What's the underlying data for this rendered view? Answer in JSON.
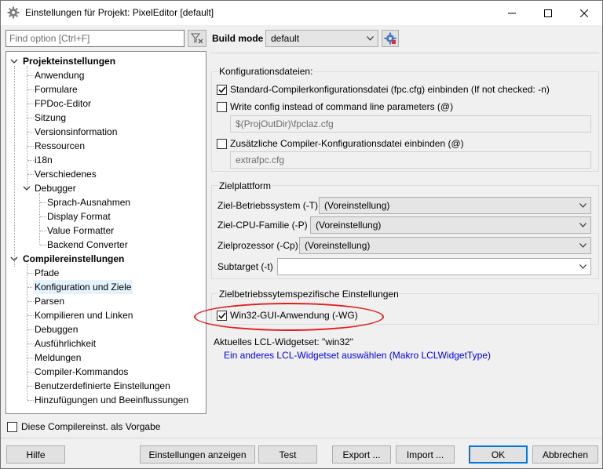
{
  "window": {
    "title": "Einstellungen für Projekt: PixelEditor [default]",
    "icon": "gear-icon"
  },
  "search": {
    "placeholder": "Find option [Ctrl+F]"
  },
  "tree": {
    "group1": "Projekteinstellungen",
    "items1": [
      "Anwendung",
      "Formulare",
      "FPDoc-Editor",
      "Sitzung",
      "Versionsinformation",
      "Ressourcen",
      "i18n",
      "Verschiedenes",
      "Debugger"
    ],
    "debugger_children": [
      "Sprach-Ausnahmen",
      "Display Format",
      "Value Formatter",
      "Backend Converter"
    ],
    "group2": "Compilereinstellungen",
    "items2": [
      "Pfade",
      "Konfiguration und Ziele",
      "Parsen",
      "Kompilieren und Linken",
      "Debuggen",
      "Ausführlichkeit",
      "Meldungen",
      "Compiler-Kommandos",
      "Benutzerdefinierte Einstellungen",
      "Hinzufügungen und Beeinflussungen"
    ],
    "selected": "Konfiguration und Ziele"
  },
  "bottom_check": {
    "label": "Diese Compilereinst. als Vorgabe",
    "checked": false
  },
  "build_mode": {
    "label": "Build mode",
    "value": "default"
  },
  "config_files": {
    "title": "Konfigurationsdateien:",
    "std_cfg": {
      "label": "Standard-Compilerkonfigurationsdatei (fpc.cfg) einbinden (If not checked: -n)",
      "checked": true
    },
    "write_cfg": {
      "label": "Write config instead of command line parameters (@)",
      "checked": false
    },
    "write_cfg_path": "$(ProjOutDir)\\fpclaz.cfg",
    "extra_cfg": {
      "label": "Zusätzliche Compiler-Konfigurationsdatei einbinden (@)",
      "checked": false
    },
    "extra_cfg_path": "extrafpc.cfg"
  },
  "target": {
    "title": "Zielplattform",
    "os_label": "Ziel-Betriebssystem (-T)",
    "os_value": "(Voreinstellung)",
    "cpu_family_label": "Ziel-CPU-Familie (-P)",
    "cpu_family_value": "(Voreinstellung)",
    "cpu_label": "Zielprozessor (-Cp)",
    "cpu_value": "(Voreinstellung)",
    "subtarget_label": "Subtarget (-t)",
    "subtarget_value": ""
  },
  "os_specific": {
    "title": "Zielbetriebssytemspezifische Einstellungen",
    "win32gui": {
      "label": "Win32-GUI-Anwendung (-WG)",
      "checked": true
    }
  },
  "lcl": {
    "current": "Aktuelles LCL-Widgetset: \"win32\"",
    "link": "Ein anderes LCL-Widgetset auswählen (Makro LCLWidgetType)"
  },
  "buttons": {
    "help": "Hilfe",
    "show_options": "Einstellungen anzeigen",
    "test": "Test",
    "export": "Export ...",
    "import": "Import ...",
    "ok": "OK",
    "cancel": "Abbrechen"
  },
  "colors": {
    "highlight": "#e02020",
    "link": "#0000ee",
    "selection": "#e5f3ff",
    "accent": "#0078d7"
  }
}
